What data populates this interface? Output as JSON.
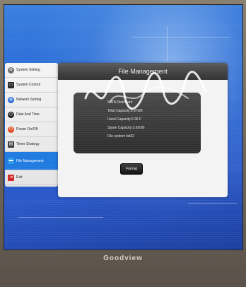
{
  "sidebar": {
    "items": [
      {
        "label": "System Setting",
        "icon": "gear-icon",
        "color": "#6c6c6c"
      },
      {
        "label": "System Control",
        "icon": "monitor-icon",
        "color": "#2a2a2a"
      },
      {
        "label": "Network Setting",
        "icon": "network-globe-icon",
        "color": "#2b6fd6"
      },
      {
        "label": "Date And Time",
        "icon": "clock-icon",
        "color": "#1a1a1a"
      },
      {
        "label": "Power On/Off",
        "icon": "power-icon",
        "color": "#e04a20"
      },
      {
        "label": "Timer Strategy",
        "icon": "timer-icon",
        "color": "#3a3a3a"
      },
      {
        "label": "File Management",
        "icon": "folder-icon",
        "color": "#2d9ae8"
      },
      {
        "label": "Exit",
        "icon": "exit-icon",
        "color": "#d02828"
      }
    ],
    "active_index": 6
  },
  "panel": {
    "title": "File Management",
    "info": {
      "line1": "SATA Disk/Hard",
      "line2": "Total Capacity:3.97GB",
      "line3": "Used Capacity:0.36 F",
      "line4": "Spare Capacity:3.62GB",
      "line5": "File system fat32"
    },
    "format_label": "Format"
  },
  "bezel": {
    "brand": "Goodview"
  }
}
